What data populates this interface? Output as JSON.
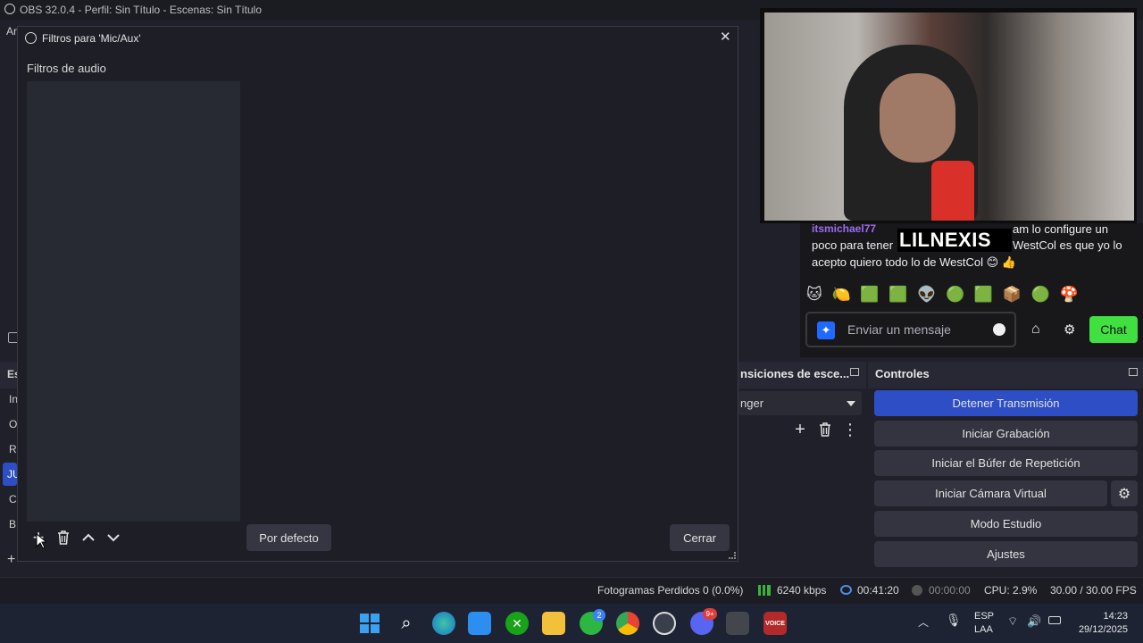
{
  "obs": {
    "title": "OBS 32.0.4 - Perfil: Sin Título - Escenas: Sin Título",
    "menu_first_letter": "Ar",
    "scenes_header_letter": "Es",
    "scene_letters": [
      "In",
      "O",
      "R",
      "JU",
      "C",
      "B"
    ]
  },
  "modal": {
    "title": "Filtros para 'Mic/Aux'",
    "section_label": "Filtros de audio",
    "default_button": "Por defecto",
    "close_button": "Cerrar",
    "close_x": "✕"
  },
  "transitions": {
    "header": "nsiciones de esce...",
    "selected": "nger"
  },
  "controls": {
    "header": "Controles",
    "buttons": {
      "stop_stream": "Detener Transmisión",
      "start_recording": "Iniciar Grabación",
      "replay_buffer": "Iniciar el Búfer de Repetición",
      "virtual_camera": "Iniciar Cámara Virtual",
      "studio_mode": "Modo Estudio",
      "settings": "Ajustes"
    },
    "accent_color": "#2d4ec4"
  },
  "stream_overlay": {
    "streamer_name": "LILNEXIS",
    "chat_user": "itsmichael77",
    "chat_line1_right": "am lo configure un",
    "chat_line2_left": "poco para tener",
    "chat_line2_right": "WestCol es que yo lo",
    "chat_line3": "acepto quiero todo lo de WestCol 😊 👍",
    "emotes": "🐱 🍋 🟩 🟩 👽 🟢 🟩 📦 🟢 🍄",
    "message_placeholder": "Enviar un mensaje",
    "chat_button": "Chat",
    "chat_button_color": "#3fe03f"
  },
  "status": {
    "dropped_frames": "Fotogramas Perdidos 0 (0.0%)",
    "bitrate": "6240 kbps",
    "stream_time": "00:41:20",
    "record_time": "00:00:00",
    "cpu": "CPU: 2.9%",
    "fps": "30.00 / 30.00 FPS"
  },
  "taskbar": {
    "language": "ESP",
    "layout": "LAA",
    "time": "14:23",
    "date": "29/12/2025",
    "whatsapp_badge": "2",
    "discord_badge": "9+",
    "voicemeeter_label": "VOICE"
  }
}
